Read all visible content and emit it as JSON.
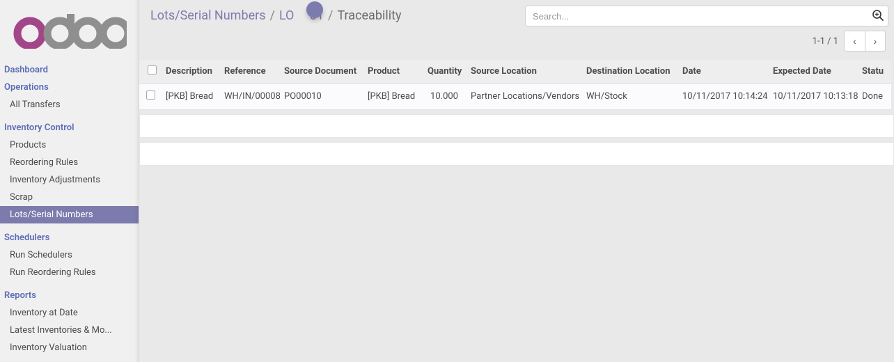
{
  "logo": {
    "brand": "odoo"
  },
  "sidebar": {
    "headers": {
      "dashboard": "Dashboard",
      "operations": "Operations",
      "inventory_control": "Inventory Control",
      "schedulers": "Schedulers",
      "reports": "Reports"
    },
    "items": {
      "all_transfers": "All Transfers",
      "products": "Products",
      "reordering_rules": "Reordering Rules",
      "inventory_adjustments": "Inventory Adjustments",
      "scrap": "Scrap",
      "lots_serial": "Lots/Serial Numbers",
      "run_schedulers": "Run Schedulers",
      "run_reordering_rules": "Run Reordering Rules",
      "inventory_at_date": "Inventory at Date",
      "latest_inventories": "Latest Inventories & Mo...",
      "inventory_valuation": "Inventory Valuation"
    }
  },
  "breadcrumb": {
    "a": "Lots/Serial Numbers",
    "b": "LO     01",
    "current": "Traceability"
  },
  "search": {
    "placeholder": "Search..."
  },
  "pager": {
    "range": "1-1 / 1"
  },
  "table": {
    "headers": {
      "description": "Description",
      "reference": "Reference",
      "source_document": "Source Document",
      "product": "Product",
      "quantity": "Quantity",
      "source_location": "Source Location",
      "destination_location": "Destination Location",
      "date": "Date",
      "expected_date": "Expected Date",
      "status": "Statu"
    },
    "rows": [
      {
        "description": "[PKB] Bread",
        "reference": "WH/IN/00008",
        "source_document": "PO00010",
        "product": "[PKB] Bread",
        "quantity": "10.000",
        "source_location": "Partner Locations/Vendors",
        "destination_location": "WH/Stock",
        "date": "10/11/2017 10:14:24",
        "expected_date": "10/11/2017 10:13:18",
        "status": "Done"
      }
    ]
  }
}
